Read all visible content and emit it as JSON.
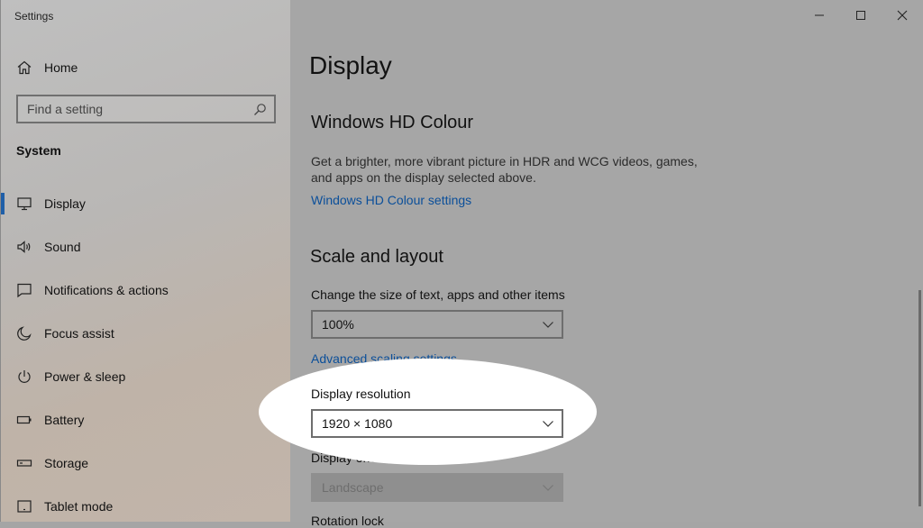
{
  "window": {
    "title": "Settings"
  },
  "sidebar": {
    "home_label": "Home",
    "search_placeholder": "Find a setting",
    "section": "System",
    "items": [
      {
        "label": "Display",
        "icon": "monitor-icon",
        "active": true
      },
      {
        "label": "Sound",
        "icon": "speaker-icon"
      },
      {
        "label": "Notifications & actions",
        "icon": "notification-icon"
      },
      {
        "label": "Focus assist",
        "icon": "moon-icon"
      },
      {
        "label": "Power & sleep",
        "icon": "power-icon"
      },
      {
        "label": "Battery",
        "icon": "battery-icon"
      },
      {
        "label": "Storage",
        "icon": "storage-icon"
      },
      {
        "label": "Tablet mode",
        "icon": "tablet-icon"
      }
    ]
  },
  "main": {
    "title": "Display",
    "hdr": {
      "heading": "Windows HD Colour",
      "description": "Get a brighter, more vibrant picture in HDR and WCG videos, games, and apps on the display selected above.",
      "link": "Windows HD Colour settings"
    },
    "scale": {
      "heading": "Scale and layout",
      "size_label": "Change the size of text, apps and other items",
      "size_value": "100%",
      "advanced_link": "Advanced scaling settings",
      "resolution_label": "Display resolution",
      "resolution_value": "1920 × 1080",
      "orientation_label": "Display orientation",
      "orientation_value": "Landscape",
      "rotation_lock_label": "Rotation lock"
    }
  },
  "colors": {
    "accent": "#1f5fa8",
    "link": "#0b4f9a",
    "spotlight": "#ffffff"
  }
}
